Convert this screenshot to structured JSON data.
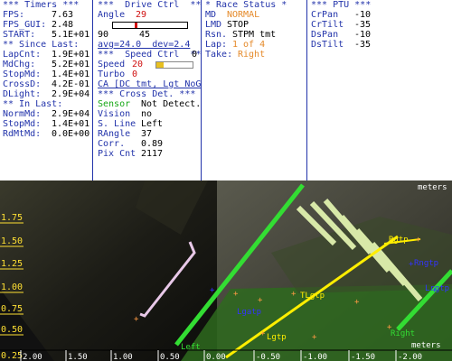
{
  "timers": {
    "header": "*** Timers ***",
    "fps_label": "FPS:",
    "fps": "7.63",
    "fps_gui_label": "FPS_GUI:",
    "fps_gui": "2.48",
    "start_label": "START:",
    "start": "5.1E+01",
    "since_header": "** Since Last:",
    "since": [
      {
        "label": "LapCnt:",
        "value": "1.9E+01"
      },
      {
        "label": "MdChg:",
        "value": "5.2E+01"
      },
      {
        "label": "StopMd:",
        "value": "1.4E+01"
      },
      {
        "label": "CrossD:",
        "value": "4.2E-01"
      },
      {
        "label": "DLight:",
        "value": "2.9E+04"
      }
    ],
    "in_header": "** In Last:",
    "in_last": [
      {
        "label": "NormMd:",
        "value": "2.9E+04"
      },
      {
        "label": "StopMd:",
        "value": "1.4E+01"
      },
      {
        "label": "RdMtMd:",
        "value": "0.0E+00"
      }
    ]
  },
  "drive": {
    "header": "***  Drive Ctrl  ***",
    "angle_label": "Angle",
    "angle": "29",
    "slider_min": "90",
    "slider_max": "0",
    "slider_mid": "45",
    "slider_level": 0.3,
    "avg_text": "avg=24.0  dev=2.4",
    "speed_header": "***  Speed Ctrl  ***",
    "speed_label": "Speed",
    "speed": "20",
    "speed_level": 0.2,
    "turbo_label": "Turbo",
    "turbo": "0",
    "ca_text": "CA [DC tmt, Lgt NoGo]",
    "cross_header": "*** Cross Det. ***",
    "cross": [
      {
        "label": "Sensor",
        "value": "Not Detect."
      },
      {
        "label": "Vision",
        "value": "no"
      },
      {
        "label": "S. Line",
        "value": "Left"
      },
      {
        "label": "RAngle",
        "value": "37"
      },
      {
        "label": "Corr.",
        "value": "0.89"
      },
      {
        "label": "Pix Cnt",
        "value": "2117"
      }
    ]
  },
  "race": {
    "header": "* Race Status *",
    "md_label": "MD",
    "md": "NORMAL",
    "lmd_label": "LMD",
    "lmd": "STOP",
    "rsn_label": "Rsn.",
    "rsn": "STPM tmt",
    "lap_label": "Lap:",
    "lap": "1 of 4",
    "take_label": "Take:",
    "take": "Right"
  },
  "ptu": {
    "header": "*** PTU ***",
    "rows": [
      {
        "label": "CrPan",
        "value": "-10"
      },
      {
        "label": "CrTilt",
        "value": "-35"
      },
      {
        "label": "DsPan",
        "value": "-10"
      },
      {
        "label": "DsTilt",
        "value": "-35"
      }
    ]
  },
  "camera": {
    "y_ticks": [
      "1.75",
      "1.50",
      "1.25",
      "1.00",
      "0.75",
      "0.50",
      "0.25"
    ],
    "x_ticks": [
      "2.00",
      "1.50",
      "1.00",
      "0.50",
      "0.00",
      "-0.50",
      "-1.00",
      "-1.50",
      "-2.00"
    ],
    "y_origin": "0.25",
    "unit": "meters",
    "labels": {
      "left": "Left",
      "right": "Right",
      "lgtp": "Lgtp",
      "tlgtp": "TLgtp",
      "rgtp": "Rgtp",
      "rngtp": "Rngtp",
      "lgatp": "Lgatp",
      "lrgtp": "Lrgtp"
    },
    "colors": {
      "green": "#33dd33",
      "yellow": "#ffee00",
      "blue": "#3333ff",
      "orange": "#ff9944"
    }
  }
}
